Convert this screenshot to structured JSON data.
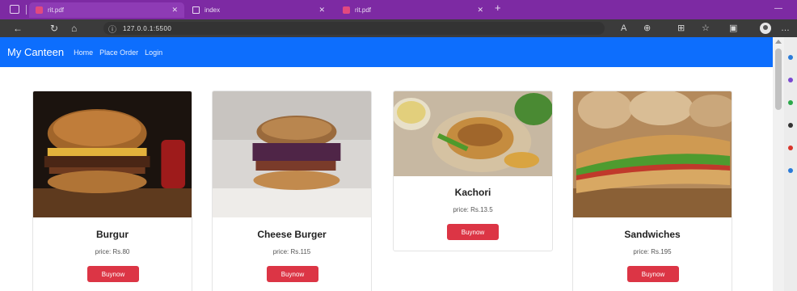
{
  "browser": {
    "tabs": [
      {
        "title": "rit.pdf",
        "active": true
      },
      {
        "title": "index",
        "active": false
      },
      {
        "title": "rit.pdf",
        "active": false
      }
    ],
    "address": "127.0.0.1:5500"
  },
  "navbar": {
    "brand": "My Canteen",
    "links": [
      "Home",
      "Place Order",
      "Login"
    ]
  },
  "products": [
    {
      "name": "Burgur",
      "price": "price: Rs.80",
      "button": "Buynow"
    },
    {
      "name": "Cheese Burger",
      "price": "price: Rs.115",
      "button": "Buynow"
    },
    {
      "name": "Kachori",
      "price": "price: Rs.13.5",
      "button": "Buynow"
    },
    {
      "name": "Sandwiches",
      "price": "price: Rs.195",
      "button": "Buynow"
    }
  ],
  "colors": {
    "tabbar": "#7d2aa3",
    "navbar": "#0d6efd",
    "buy_button": "#dc3545"
  }
}
